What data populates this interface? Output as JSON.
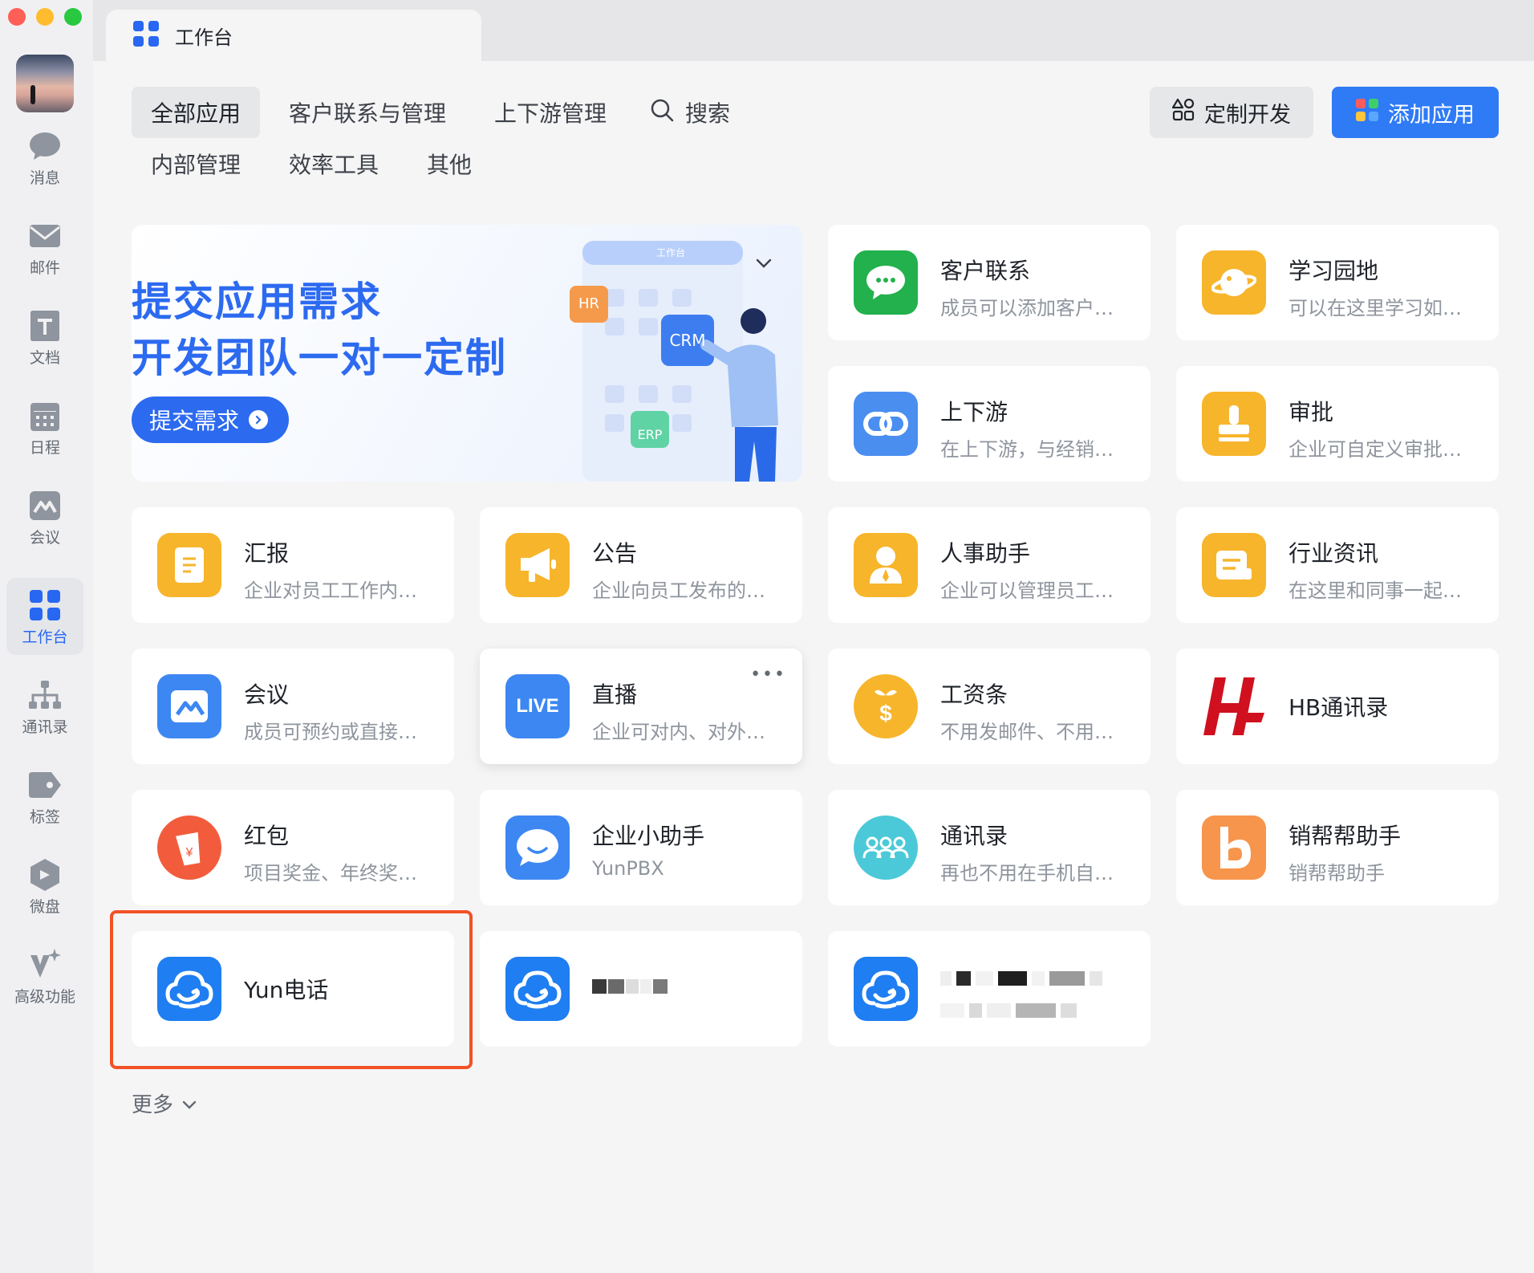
{
  "sidebar": {
    "items": [
      {
        "label": "消息",
        "icon": "chat-bubble-icon"
      },
      {
        "label": "邮件",
        "icon": "mail-icon"
      },
      {
        "label": "文档",
        "icon": "document-icon"
      },
      {
        "label": "日程",
        "icon": "calendar-icon"
      },
      {
        "label": "会议",
        "icon": "meeting-icon"
      },
      {
        "label": "工作台",
        "icon": "workbench-grid-icon",
        "active": true
      },
      {
        "label": "通讯录",
        "icon": "org-chart-icon"
      },
      {
        "label": "标签",
        "icon": "tag-icon"
      },
      {
        "label": "微盘",
        "icon": "cloud-drive-icon"
      },
      {
        "label": "高级功能",
        "icon": "sparkle-icon"
      }
    ],
    "accent": "#2867f1"
  },
  "tab": {
    "title": "工作台"
  },
  "categories": [
    {
      "label": "全部应用",
      "active": true
    },
    {
      "label": "客户联系与管理"
    },
    {
      "label": "上下游管理"
    },
    {
      "label": "搜索"
    },
    {
      "label": "内部管理"
    },
    {
      "label": "效率工具"
    },
    {
      "label": "其他"
    }
  ],
  "actions": {
    "custom_dev": "定制开发",
    "add_app": "添加应用",
    "add_color": "#2f7bf6"
  },
  "banner": {
    "line1": "提交应用需求",
    "line2": "开发团队一对一定制",
    "button": "提交需求",
    "mock_title": "工作台",
    "tags": [
      "HR",
      "CRM",
      "ERP"
    ]
  },
  "apps": [
    {
      "name": "客户联系",
      "desc": "成员可以添加客户…",
      "icon": "wechat-chat-icon",
      "color": "#22b14c"
    },
    {
      "name": "学习园地",
      "desc": "可以在这里学习如…",
      "icon": "planet-icon",
      "color": "#f7b52c"
    },
    {
      "name": "上下游",
      "desc": "在上下游，与经销…",
      "icon": "link-icon",
      "color": "#4a8ef0"
    },
    {
      "name": "审批",
      "desc": "企业可自定义审批…",
      "icon": "stamp-icon",
      "color": "#f7b52c"
    },
    {
      "name": "汇报",
      "desc": "企业对员工工作内…",
      "icon": "report-icon",
      "color": "#f7b52c"
    },
    {
      "name": "公告",
      "desc": "企业向员工发布的…",
      "icon": "megaphone-icon",
      "color": "#f7b52c"
    },
    {
      "name": "人事助手",
      "desc": "企业可以管理员工…",
      "icon": "person-icon",
      "color": "#f7b52c"
    },
    {
      "name": "行业资讯",
      "desc": "在这里和同事一起…",
      "icon": "news-icon",
      "color": "#f7b52c"
    },
    {
      "name": "会议",
      "desc": "成员可预约或直接…",
      "icon": "meeting-icon",
      "color": "#3d87f2"
    },
    {
      "name": "直播",
      "desc": "企业可对内、对外…",
      "icon": "live-icon",
      "color": "#3d87f2",
      "badge": "LIVE"
    },
    {
      "name": "工资条",
      "desc": "不用发邮件、不用…",
      "icon": "salary-icon",
      "color": "#f7b52c"
    },
    {
      "name": "HB通讯录",
      "desc": "",
      "icon": "hb-logo-icon",
      "color": "#d0101e"
    },
    {
      "name": "红包",
      "desc": "项目奖金、年终奖…",
      "icon": "red-packet-icon",
      "color": "#f25c3c"
    },
    {
      "name": "企业小助手",
      "desc": "YunPBX",
      "icon": "smile-chat-icon",
      "color": "#3d87f2"
    },
    {
      "name": "通讯录",
      "desc": "再也不用在手机自…",
      "icon": "people-group-icon",
      "color": "#4cc9d8"
    },
    {
      "name": "销帮帮助手",
      "desc": "销帮帮助手",
      "icon": "b-logo-icon",
      "color": "#f7954c"
    },
    {
      "name": "Yun电话",
      "desc": "",
      "icon": "cloud-phone-icon",
      "color": "#1e7ef2",
      "highlighted": true
    },
    {
      "name": "",
      "desc": "",
      "icon": "cloud-phone-icon",
      "color": "#1e7ef2",
      "redacted": true
    },
    {
      "name": "",
      "desc": "",
      "icon": "cloud-phone-icon",
      "color": "#1e7ef2",
      "redacted": true
    }
  ],
  "footer": {
    "more": "更多"
  }
}
